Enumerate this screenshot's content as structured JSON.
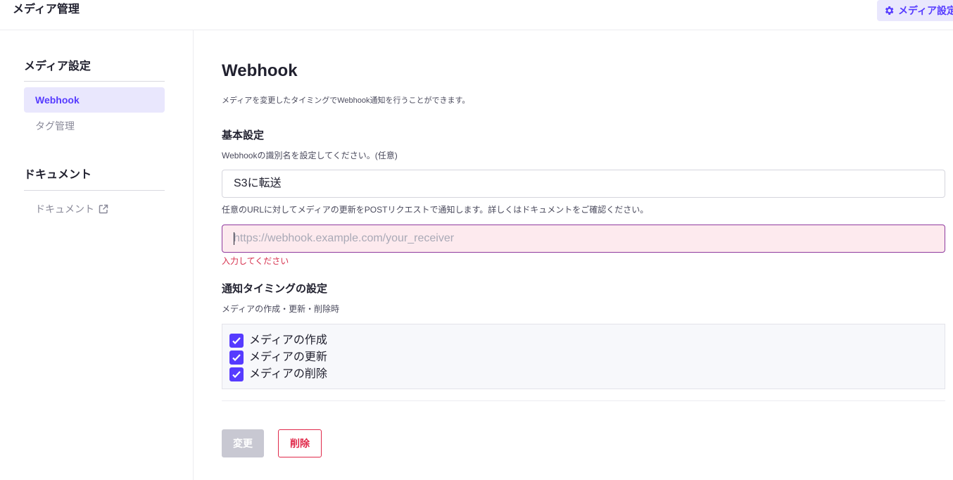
{
  "header": {
    "title": "メディア管理",
    "settings_button": {
      "label": "メディア設定",
      "icon": "gear-icon"
    }
  },
  "sidebar": {
    "sections": [
      {
        "heading": "メディア設定",
        "items": [
          {
            "label": "Webhook",
            "active": true
          },
          {
            "label": "タグ管理",
            "active": false
          }
        ]
      },
      {
        "heading": "ドキュメント",
        "items": [
          {
            "label": "ドキュメント",
            "icon": "external-link-icon"
          }
        ]
      }
    ]
  },
  "main": {
    "title": "Webhook",
    "description": "メディアを変更したタイミングでWebhook通知を行うことができます。",
    "basic": {
      "heading": "基本設定",
      "name_help": "Webhookの識別名を設定してください。(任意)",
      "name_value": "S3に転送",
      "url_help_prefix": "任意のURLに対してメディアの更新をPOSTリクエストで通知します。詳しくは",
      "url_help_link": "ドキュメント",
      "url_help_suffix": "をご確認ください。",
      "url_value": "",
      "url_placeholder": "https://webhook.example.com/your_receiver",
      "url_error": "入力してください"
    },
    "timing": {
      "heading": "通知タイミングの設定",
      "help": "メディアの作成・更新・削除時",
      "options": [
        {
          "label": "メディアの作成",
          "checked": true
        },
        {
          "label": "メディアの更新",
          "checked": true
        },
        {
          "label": "メディアの削除",
          "checked": true
        }
      ]
    },
    "actions": {
      "submit_label": "変更",
      "delete_label": "削除"
    }
  },
  "colors": {
    "accent": "#563bff",
    "active_bg": "#e9e7fd",
    "error": "#d6304d",
    "danger": "#e0294a",
    "disabled_button": "#c8c8d2",
    "error_field_bg": "#fdeaee"
  }
}
